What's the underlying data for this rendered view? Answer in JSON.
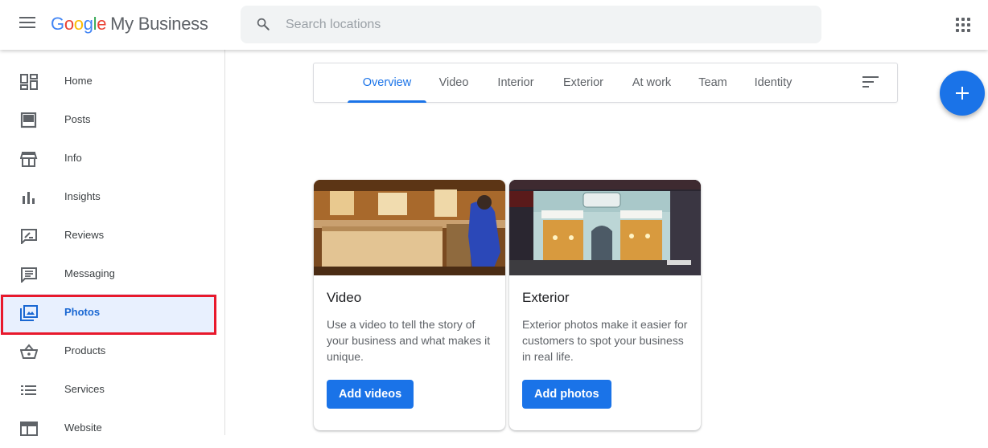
{
  "app": {
    "brand_google": [
      "G",
      "o",
      "o",
      "g",
      "l",
      "e"
    ],
    "brand_product": "My Business"
  },
  "search": {
    "placeholder": "Search locations"
  },
  "sidebar": {
    "items": [
      {
        "label": "Home",
        "icon": "dashboard-icon"
      },
      {
        "label": "Posts",
        "icon": "posts-icon"
      },
      {
        "label": "Info",
        "icon": "storefront-icon"
      },
      {
        "label": "Insights",
        "icon": "bar-chart-icon"
      },
      {
        "label": "Reviews",
        "icon": "rate-review-icon"
      },
      {
        "label": "Messaging",
        "icon": "message-icon"
      },
      {
        "label": "Photos",
        "icon": "photo-library-icon",
        "active": true
      },
      {
        "label": "Products",
        "icon": "basket-icon"
      },
      {
        "label": "Services",
        "icon": "list-icon"
      },
      {
        "label": "Website",
        "icon": "web-icon"
      }
    ]
  },
  "tabs": [
    {
      "label": "Overview",
      "active": true
    },
    {
      "label": "Video"
    },
    {
      "label": "Interior"
    },
    {
      "label": "Exterior"
    },
    {
      "label": "At work"
    },
    {
      "label": "Team"
    },
    {
      "label": "Identity"
    }
  ],
  "cards": [
    {
      "title": "Video",
      "description": "Use a video to tell the story of your business and what makes it unique.",
      "button": "Add videos"
    },
    {
      "title": "Exterior",
      "description": "Exterior photos make it easier for customers to spot your business in real life.",
      "button": "Add photos"
    }
  ],
  "colors": {
    "accent": "#1a73e8",
    "active_nav_bg": "#e8f0fe",
    "highlight_box": "#e8192c"
  }
}
